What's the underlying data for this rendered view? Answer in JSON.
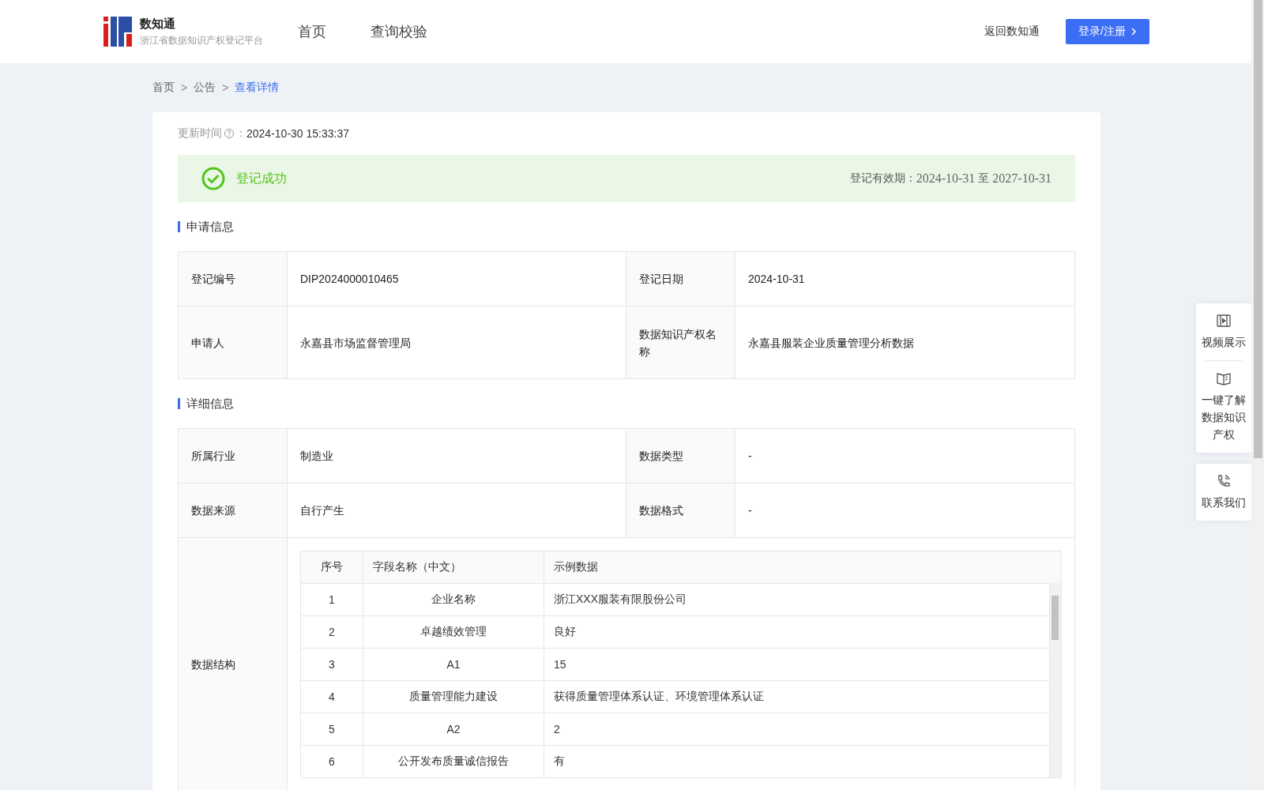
{
  "header": {
    "logo": {
      "title": "数知通",
      "subtitle": "浙江省数据知识产权登记平台"
    },
    "nav": [
      {
        "label": "首页",
        "selected": false
      },
      {
        "label": "查询校验",
        "selected": false
      }
    ],
    "back_link": "返回数知通",
    "login_button": "登录/注册"
  },
  "breadcrumb": [
    {
      "label": "首页",
      "current": false
    },
    {
      "label": "公告",
      "current": false
    },
    {
      "label": "查看详情",
      "current": true
    }
  ],
  "breadcrumb_separator": ">",
  "update": {
    "label": "更新时间",
    "colon": "：",
    "value": "2024-10-30 15:33:37"
  },
  "status": {
    "text": "登记成功",
    "validity_label": "登记有效期：",
    "validity_from": "2024-10-31",
    "validity_to_word": "至",
    "validity_to": "2027-10-31"
  },
  "sections": [
    {
      "title": "申请信息",
      "rows": [
        {
          "cells": [
            {
              "label": "登记编号",
              "value": "DIP2024000010465"
            },
            {
              "label": "登记日期",
              "value": "2024-10-31"
            }
          ]
        },
        {
          "cells": [
            {
              "label": "申请人",
              "value": "永嘉县市场监督管理局"
            },
            {
              "label": "数据知识产权名称",
              "value": "永嘉县服装企业质量管理分析数据"
            }
          ]
        }
      ]
    },
    {
      "title": "详细信息",
      "rows": [
        {
          "cells": [
            {
              "label": "所属行业",
              "value": "制造业"
            },
            {
              "label": "数据类型",
              "value": "-"
            }
          ]
        },
        {
          "cells": [
            {
              "label": "数据来源",
              "value": "自行产生"
            },
            {
              "label": "数据格式",
              "value": "-"
            }
          ]
        }
      ],
      "structure": {
        "label": "数据结构",
        "columns": [
          "序号",
          "字段名称（中文）",
          "示例数据"
        ],
        "rows": [
          [
            "1",
            "企业名称",
            "浙江XXX服装有限股份公司"
          ],
          [
            "2",
            "卓越绩效管理",
            "良好"
          ],
          [
            "3",
            "A1",
            "15"
          ],
          [
            "4",
            "质量管理能力建设",
            "获得质量管理体系认证、环境管理体系认证"
          ],
          [
            "5",
            "A2",
            "2"
          ],
          [
            "6",
            "公开发布质量诚信报告",
            "有"
          ]
        ]
      }
    }
  ],
  "side_panel": [
    {
      "kind": "video",
      "label": "视频展示"
    },
    {
      "kind": "book",
      "label": "一键了解数据知识产权"
    },
    {
      "kind": "phone",
      "label": "联系我们"
    }
  ]
}
